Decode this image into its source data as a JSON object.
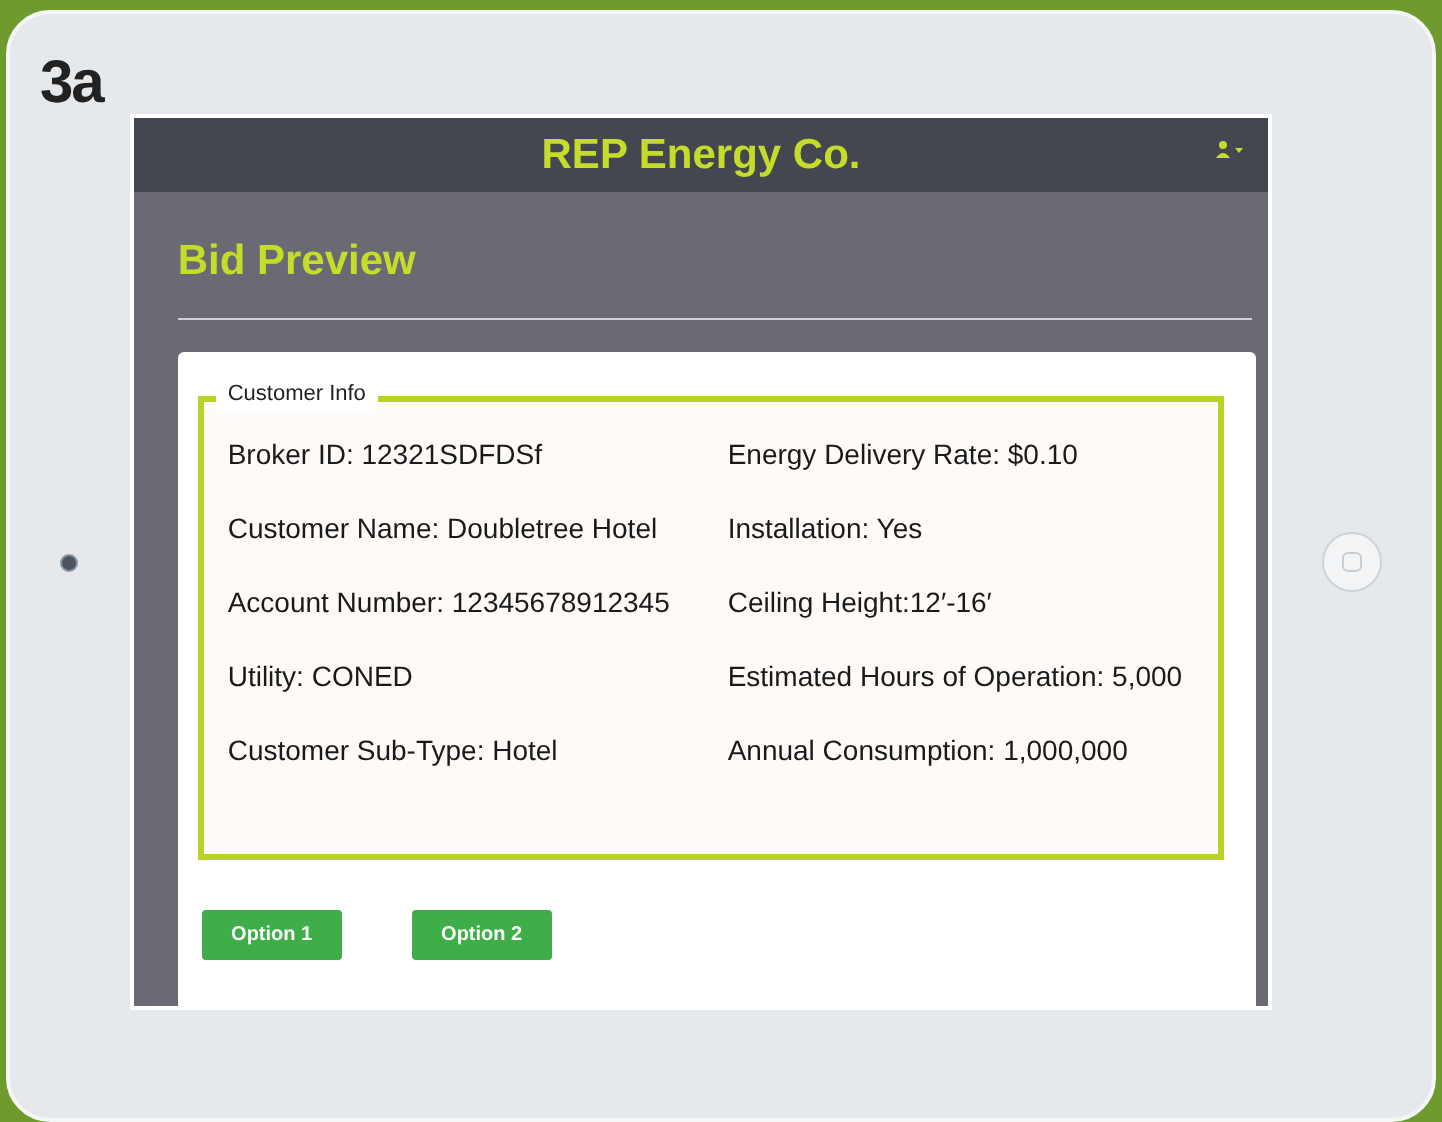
{
  "figure_label": "3a",
  "app": {
    "title": "REP Energy Co."
  },
  "page_title": "Bid Preview",
  "customer_info": {
    "legend": "Customer Info",
    "rows": [
      {
        "left": "Broker ID: 12321SDFDSf",
        "right": "Energy Delivery Rate: $0.10"
      },
      {
        "left": "Customer Name: Doubletree Hotel",
        "right": "Installation: Yes"
      },
      {
        "left": "Account Number: 12345678912345",
        "right": "Ceiling Height:12′-16′"
      },
      {
        "left": "Utility: CONED",
        "right": "Estimated Hours of Operation: 5,000"
      },
      {
        "left": "Customer Sub-Type: Hotel",
        "right": "Annual Consumption: 1,000,000"
      }
    ]
  },
  "buttons": [
    "Option 1",
    "Option 2"
  ]
}
